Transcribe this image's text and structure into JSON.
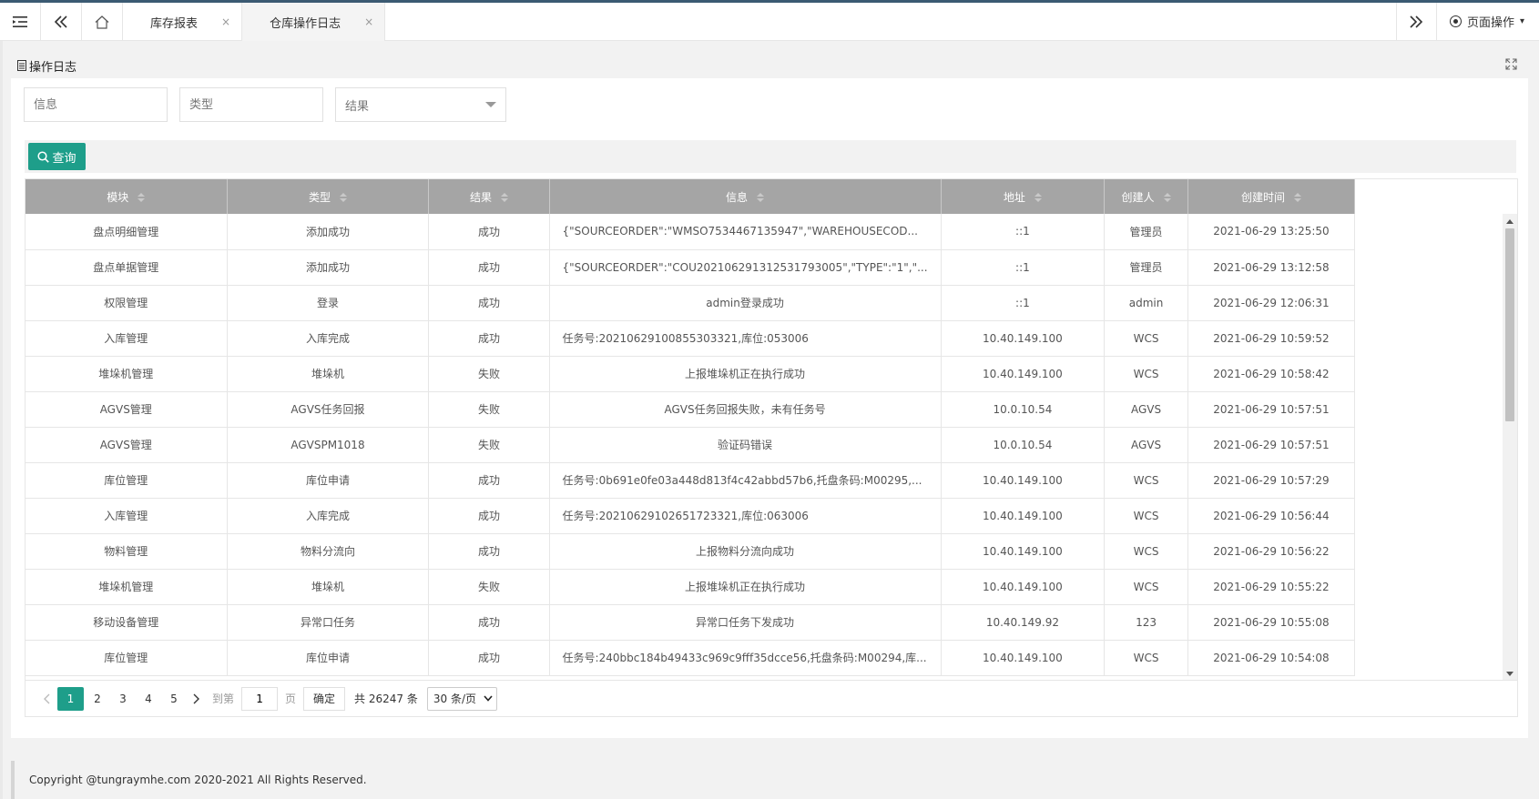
{
  "tabs": {
    "items": [
      {
        "label": "库存报表",
        "close": "×"
      },
      {
        "label": "仓库操作日志",
        "close": "×"
      }
    ],
    "page_ops_label": "页面操作"
  },
  "panel": {
    "title": "操作日志"
  },
  "filters": {
    "info_placeholder": "信息",
    "type_placeholder": "类型",
    "result_placeholder": "结果"
  },
  "toolbar": {
    "query_label": "查询"
  },
  "table": {
    "columns": [
      "模块",
      "类型",
      "结果",
      "信息",
      "地址",
      "创建人",
      "创建时间"
    ],
    "rows": [
      [
        "盘点明细管理",
        "添加成功",
        "成功",
        "{\"SOURCEORDER\":\"WMSO7534467135947\",\"WAREHOUSECOD...",
        "::1",
        "管理员",
        "2021-06-29 13:25:50"
      ],
      [
        "盘点单据管理",
        "添加成功",
        "成功",
        "{\"SOURCEORDER\":\"COU20210629131253179300​5\",\"TYPE\":\"1\",\"...",
        "::1",
        "管理员",
        "2021-06-29 13:12:58"
      ],
      [
        "权限管理",
        "登录",
        "成功",
        "admin登录成功",
        "::1",
        "admin",
        "2021-06-29 12:06:31"
      ],
      [
        "入库管理",
        "入库完成",
        "成功",
        "任务号:20210629100855303321,库位:053006",
        "10.40.149.100",
        "WCS",
        "2021-06-29 10:59:52"
      ],
      [
        "堆垛机管理",
        "堆垛机",
        "失败",
        "上报堆垛机正在执行成功",
        "10.40.149.100",
        "WCS",
        "2021-06-29 10:58:42"
      ],
      [
        "AGVS管理",
        "AGVS任务回报",
        "失败",
        "AGVS任务回报失败，未有任务号",
        "10.0.10.54",
        "AGVS",
        "2021-06-29 10:57:51"
      ],
      [
        "AGVS管理",
        "AGVSPM1018",
        "失败",
        "验证码错误",
        "10.0.10.54",
        "AGVS",
        "2021-06-29 10:57:51"
      ],
      [
        "库位管理",
        "库位申请",
        "成功",
        "任务号:0b691e0fe03a448d813f4c42abbd57b6,托盘条码:M00295,...",
        "10.40.149.100",
        "WCS",
        "2021-06-29 10:57:29"
      ],
      [
        "入库管理",
        "入库完成",
        "成功",
        "任务号:20210629102651723321,库位:063006",
        "10.40.149.100",
        "WCS",
        "2021-06-29 10:56:44"
      ],
      [
        "物料管理",
        "物料分流向",
        "成功",
        "上报物料分流向成功",
        "10.40.149.100",
        "WCS",
        "2021-06-29 10:56:22"
      ],
      [
        "堆垛机管理",
        "堆垛机",
        "失败",
        "上报堆垛机正在执行成功",
        "10.40.149.100",
        "WCS",
        "2021-06-29 10:55:22"
      ],
      [
        "移动设备管理",
        "异常口任务",
        "成功",
        "异常口任务下发成功",
        "10.40.149.92",
        "123",
        "2021-06-29 10:55:08"
      ],
      [
        "库位管理",
        "库位申请",
        "成功",
        "任务号:240bbc184b49433c969c9fff35dcce56,托盘条码:M00294,库...",
        "10.40.149.100",
        "WCS",
        "2021-06-29 10:54:08"
      ]
    ]
  },
  "pager": {
    "pages": [
      "1",
      "2",
      "3",
      "4",
      "5"
    ],
    "current": "1",
    "goto_label": "到第",
    "goto_value": "1",
    "page_label": "页",
    "ok_label": "确定",
    "total_label": "共 26247 条",
    "size_label": "30 条/页"
  },
  "footer": {
    "copyright": "Copyright @tungraymhe.com 2020-2021 All Rights Reserved."
  },
  "colors": {
    "accent": "#1e9e8a",
    "header_bg": "#a5a5a5"
  }
}
